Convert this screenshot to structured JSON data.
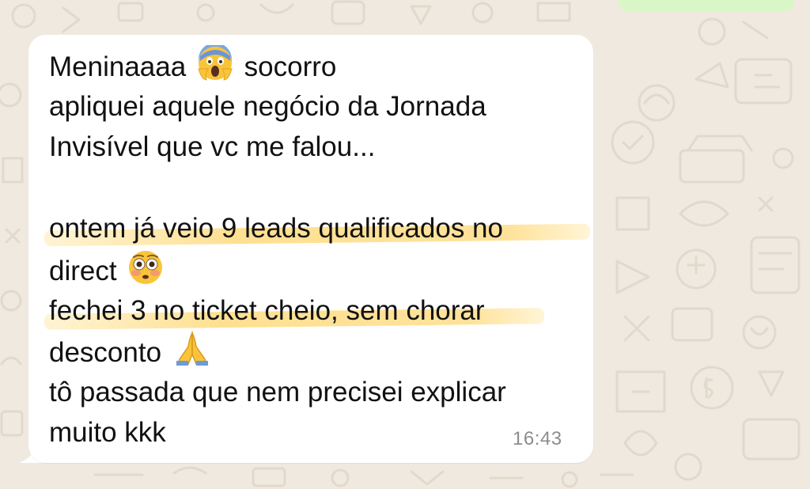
{
  "chat": {
    "message": {
      "line_1_before_emoji": "Meninaaaa",
      "line_1_emoji": "scream-emoji",
      "line_1_after_emoji": "socorro",
      "line_2": "apliquei aquele negócio da Jornada",
      "line_3": "Invisível que vc me falou...",
      "line_5": "ontem já veio 9 leads qualificados no",
      "line_6_text": "direct",
      "line_6_emoji": "flushed-face-emoji",
      "line_7": "fechei 3 no ticket cheio, sem chorar",
      "line_8_text": "desconto",
      "line_8_emoji": "folded-hands-emoji",
      "line_9": "tô passada que nem precisei explicar",
      "line_10": "muito kkk",
      "timestamp": "16:43"
    }
  },
  "colors": {
    "wallpaper": "#f0e9df",
    "bubble": "#ffffff",
    "outgoing_bubble": "#d9f7c6",
    "highlight": "#ffd66e",
    "timestamp": "#8d8d8d",
    "text": "#111111"
  }
}
